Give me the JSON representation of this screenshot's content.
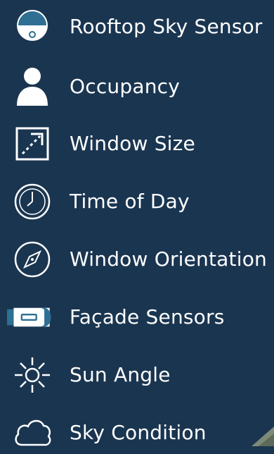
{
  "legend": {
    "items": [
      {
        "label": "Rooftop Sky Sensor",
        "icon": "rooftop-sensor-icon"
      },
      {
        "label": "Occupancy",
        "icon": "person-icon"
      },
      {
        "label": "Window Size",
        "icon": "resize-arrow-icon"
      },
      {
        "label": "Time of Day",
        "icon": "clock-icon"
      },
      {
        "label": "Window Orientation",
        "icon": "compass-icon"
      },
      {
        "label": "Façade Sensors",
        "icon": "facade-sensor-icon"
      },
      {
        "label": "Sun Angle",
        "icon": "sun-icon"
      },
      {
        "label": "Sky Condition",
        "icon": "cloud-icon"
      }
    ]
  },
  "colors": {
    "background": "#1a3550",
    "icon": "#ffffff",
    "accent": "#2e6f93"
  }
}
